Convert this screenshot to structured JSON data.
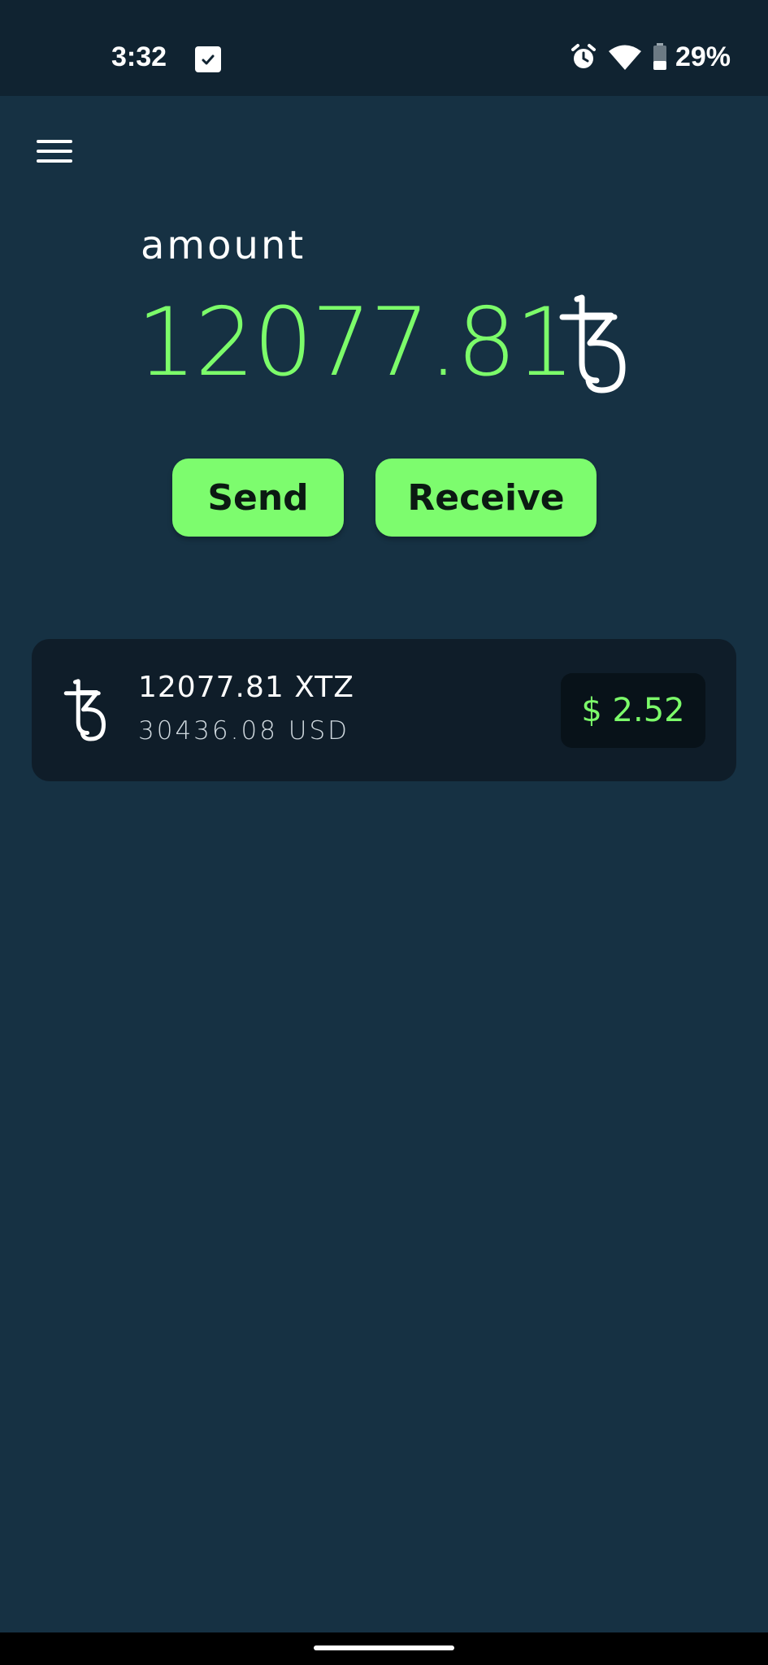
{
  "status_bar": {
    "time": "3:32",
    "notification_icon": "checkbox-notification-icon",
    "alarm_icon": "alarm-icon",
    "wifi_icon": "wifi-icon",
    "battery_icon": "battery-icon",
    "battery_level": "29%"
  },
  "header": {
    "menu_icon": "hamburger-menu-icon"
  },
  "balance": {
    "label": "amount",
    "value": "12077.81",
    "currency_icon": "tezos-icon"
  },
  "actions": {
    "send_label": "Send",
    "receive_label": "Receive"
  },
  "tokens": [
    {
      "icon": "tezos-icon",
      "amount": "12077.81 XTZ",
      "usd_value": "30436.08 USD",
      "price": "$ 2.52"
    }
  ],
  "colors": {
    "background": "#163143",
    "status_bar": "#102331",
    "accent_green": "#7cfc6a",
    "card": "#0f1d29",
    "price_badge": "#081219"
  }
}
